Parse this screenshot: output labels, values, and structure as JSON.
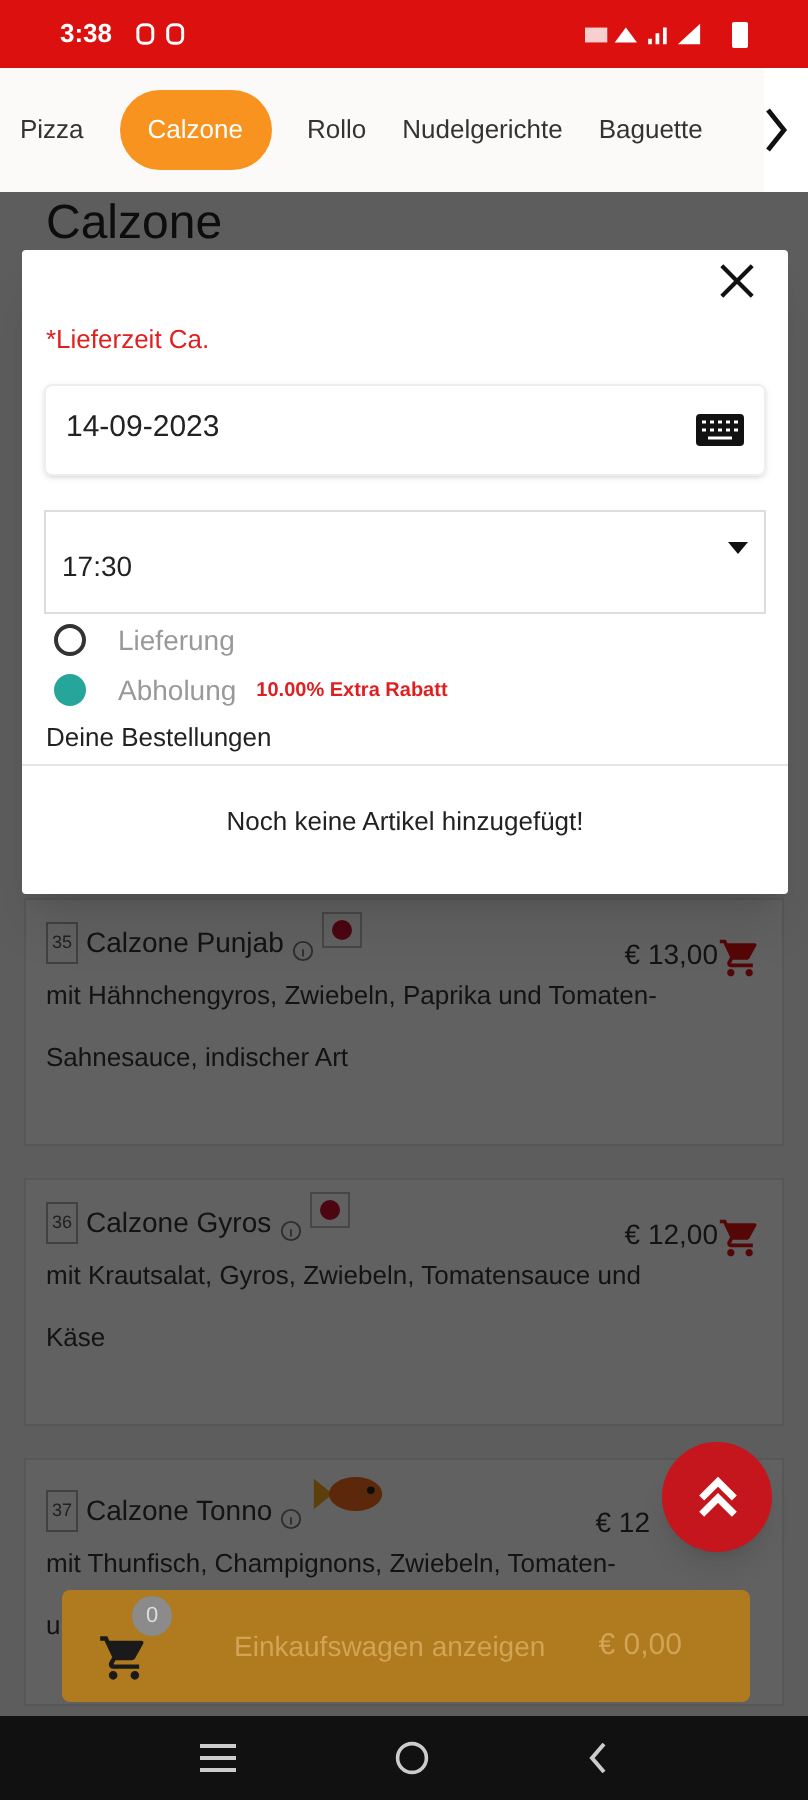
{
  "status_bar": {
    "time": "3:38"
  },
  "tabs": [
    {
      "label": "Pizza",
      "selected": false
    },
    {
      "label": "Calzone",
      "selected": true
    },
    {
      "label": "Rollo",
      "selected": false
    },
    {
      "label": "Nudelgerichte",
      "selected": false
    },
    {
      "label": "Baguette",
      "selected": false
    }
  ],
  "page_title": "Calzone",
  "items": [
    {
      "number": "35",
      "name": "Calzone Punjab",
      "kind": "flag",
      "price": "€ 13,00",
      "cart": true,
      "description": [
        "mit Hähnchengyros, Zwiebeln, Paprika und Tomaten-",
        "Sahnesauce, indischer Art"
      ]
    },
    {
      "number": "36",
      "name": "Calzone Gyros",
      "kind": "flag",
      "price": "€ 12,00",
      "cart": true,
      "description": [
        "mit Krautsalat, Gyros, Zwiebeln, Tomatensauce und",
        "Käse"
      ]
    },
    {
      "number": "37",
      "name": "Calzone Tonno",
      "kind": "fish",
      "price": "€ 12",
      "cart": false,
      "description": [
        "mit Thunfisch, Champignons, Zwiebeln, Tomaten-",
        "u"
      ]
    }
  ],
  "cart_bar": {
    "count": "0",
    "label": "Einkaufswagen anzeigen",
    "total": "€ 0,00"
  },
  "modal": {
    "required_label": "*Lieferzeit Ca.",
    "date": "14-09-2023",
    "time": "17:30",
    "options": [
      {
        "label": "Lieferung",
        "selected": false
      },
      {
        "label": "Abholung",
        "selected": true,
        "note": "10.00% Extra Rabatt"
      }
    ],
    "orders_heading": "Deine Bestellungen",
    "empty_message": "Noch keine Artikel hinzugefügt!"
  }
}
